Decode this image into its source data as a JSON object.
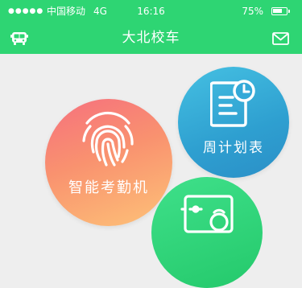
{
  "status_bar": {
    "signal": "●●●●●",
    "carrier": "中国移动",
    "network": "4G",
    "time": "16:16",
    "battery_percent": "75%",
    "battery_level": 0.75
  },
  "nav": {
    "title": "大北校车",
    "left_icon": "bus-icon",
    "right_icon": "mail-icon"
  },
  "tiles": {
    "attendance": {
      "label": "智能考勤机",
      "icon": "fingerprint-icon"
    },
    "weekly_plan": {
      "label": "周计划表",
      "icon": "calendar-clock-icon"
    },
    "third": {
      "icon": "equipment-icon"
    }
  },
  "colors": {
    "header_bg": "#2ed573",
    "page_bg": "#eeeeee",
    "attendance_gradient": [
      "#f6707e",
      "#fdc278"
    ],
    "weekly_gradient": [
      "#45c0e2",
      "#2b8fc7"
    ],
    "third_gradient": [
      "#3fe08a",
      "#24c96b"
    ]
  }
}
